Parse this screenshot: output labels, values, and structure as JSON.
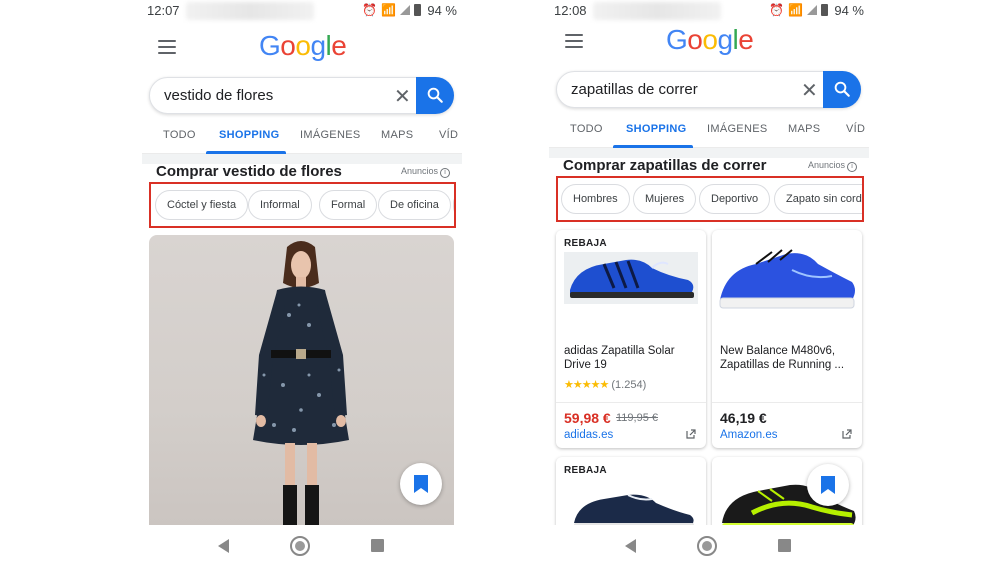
{
  "phones": [
    {
      "status": {
        "time": "12:07",
        "battery": "94 %"
      },
      "logo": "Google",
      "search": {
        "query": "vestido de flores"
      },
      "tabs": [
        "TODO",
        "SHOPPING",
        "IMÁGENES",
        "MAPS",
        "VÍD"
      ],
      "active_tab": "SHOPPING",
      "section": {
        "title": "Comprar vestido de flores",
        "ads_label": "Anuncios"
      },
      "chips": [
        "Cóctel y fiesta",
        "Informal",
        "Formal",
        "De oficina"
      ]
    },
    {
      "status": {
        "time": "12:08",
        "battery": "94 %"
      },
      "logo": "Google",
      "search": {
        "query": "zapatillas de correr"
      },
      "tabs": [
        "TODO",
        "SHOPPING",
        "IMÁGENES",
        "MAPS",
        "VÍD"
      ],
      "active_tab": "SHOPPING",
      "section": {
        "title": "Comprar zapatillas de correr",
        "ads_label": "Anuncios"
      },
      "chips": [
        "Hombres",
        "Mujeres",
        "Deportivo",
        "Zapato sin cordo..."
      ],
      "products": [
        {
          "badge": "REBAJA",
          "name": "adidas Zapatilla Solar Drive 19",
          "stars": "★★★★★",
          "rating_value": 4.5,
          "reviews": "(1.254)",
          "price": "59,98 €",
          "old_price": "119,95 €",
          "store": "adidas.es"
        },
        {
          "name": "New Balance M480v6, Zapatillas de Running ...",
          "price": "46,19 €",
          "store": "Amazon.es"
        },
        {
          "badge": "REBAJA"
        }
      ]
    }
  ],
  "colors": {
    "accent": "#1a73e8",
    "highlight_border": "#d93025",
    "sale_price": "#d93025",
    "star": "#fbbc04"
  },
  "icons": [
    "menu-icon",
    "clear-icon",
    "search-icon",
    "info-icon",
    "bookmark-icon",
    "external-link-icon",
    "back-nav-icon",
    "home-nav-icon",
    "recents-nav-icon"
  ]
}
